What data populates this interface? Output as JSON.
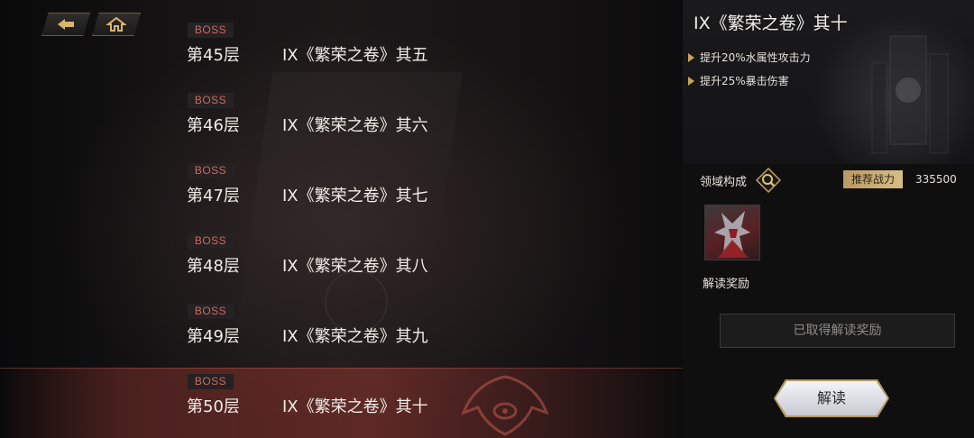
{
  "floors": [
    {
      "badge": "BOSS",
      "floor": "第45层",
      "name": "IX《繁荣之卷》其五"
    },
    {
      "badge": "BOSS",
      "floor": "第46层",
      "name": "IX《繁荣之卷》其六"
    },
    {
      "badge": "BOSS",
      "floor": "第47层",
      "name": "IX《繁荣之卷》其七"
    },
    {
      "badge": "BOSS",
      "floor": "第48层",
      "name": "IX《繁荣之卷》其八"
    },
    {
      "badge": "BOSS",
      "floor": "第49层",
      "name": "IX《繁荣之卷》其九"
    },
    {
      "badge": "BOSS",
      "floor": "第50层",
      "name": "IX《繁荣之卷》其十"
    }
  ],
  "selected_floor": "第50层",
  "panel": {
    "title": "IX《繁荣之卷》其十",
    "buffs": [
      "提升20%水属性攻击力",
      "提升25%暴击伤害"
    ],
    "domain_label": "领域构成",
    "power_tag": "推荐战力",
    "power_value": "335500",
    "reward_label": "解读奖励",
    "reward_status": "已取得解读奖励",
    "decode_button": "解读"
  },
  "icons": {
    "back": "back-arrow-icon",
    "home": "home-icon",
    "domain": "search-icon"
  },
  "colors": {
    "accent_gold": "#c9a45a",
    "boss_red": "#c96a62",
    "selected_row": "#82322c"
  }
}
